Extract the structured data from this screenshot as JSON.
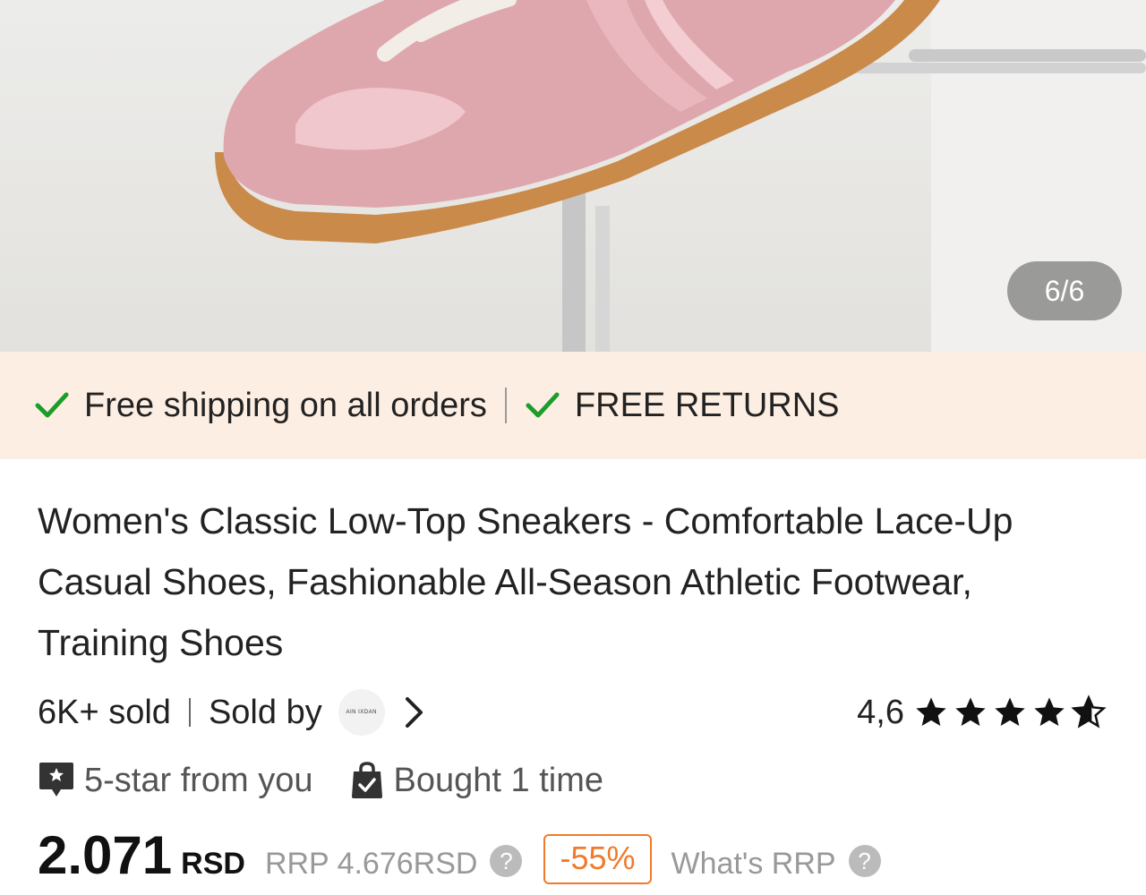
{
  "gallery": {
    "counter": "6/6"
  },
  "shipping_bar": {
    "free_shipping": "Free shipping on all orders",
    "free_returns": "FREE RETURNS",
    "check_color": "#1a9e2a"
  },
  "product": {
    "title": "Women's Classic Low-Top Sneakers - Comfortable Lace-Up Casual Shoes, Fashionable All-Season Athletic Footwear, Training Shoes",
    "sold_count": "6K+ sold",
    "sold_by_label": "Sold by",
    "seller_logo_text": "AIN IXDAN",
    "rating_value": "4,6",
    "rating_stars": 4.6,
    "badge_five_star": "5-star from you",
    "badge_bought": "Bought 1 time"
  },
  "pricing": {
    "price": "2.071",
    "currency": "RSD",
    "rrp": "RRP 4.676RSD",
    "discount": "-55%",
    "whats_rrp": "What's RRP",
    "discount_color": "#f07a2a"
  }
}
